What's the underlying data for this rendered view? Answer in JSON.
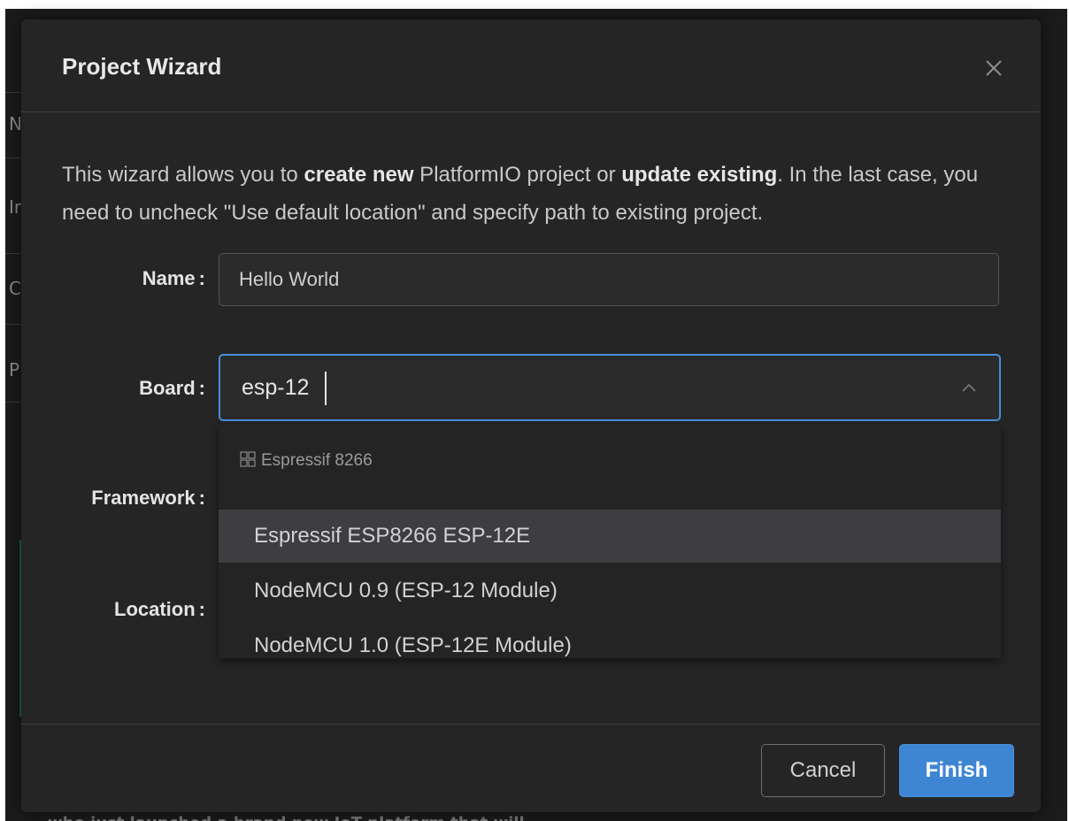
{
  "modal": {
    "title": "Project Wizard",
    "intro": {
      "part1": "This wizard allows you to ",
      "bold1": "create new",
      "part2": " PlatformIO project or ",
      "bold2": "update existing",
      "part3": ". In the last case, you need to uncheck \"Use default location\" and specify path to existing project."
    },
    "form": {
      "name_label": "Name",
      "name_value": "Hello World",
      "board_label": "Board",
      "board_value": "esp-12",
      "framework_label": "Framework",
      "location_label": "Location",
      "colon": ":"
    },
    "dropdown": {
      "group": "Espressif 8266",
      "options": [
        {
          "label": "Espressif ESP8266 ESP-12E",
          "selected": true
        },
        {
          "label": "NodeMCU 0.9 (ESP-12 Module)",
          "selected": false
        },
        {
          "label": "NodeMCU 1.0 (ESP-12E Module)",
          "selected": false
        }
      ]
    },
    "footer": {
      "cancel_label": "Cancel",
      "finish_label": "Finish"
    }
  },
  "background": {
    "side_letters": [
      "N",
      "Ir",
      "C",
      "P"
    ],
    "bottom_text": "who just launched a brand new IoT platform that will"
  },
  "colors": {
    "accent": "#3e86d4",
    "modal_bg": "#252526",
    "selected_option_bg": "#3d3d42"
  }
}
